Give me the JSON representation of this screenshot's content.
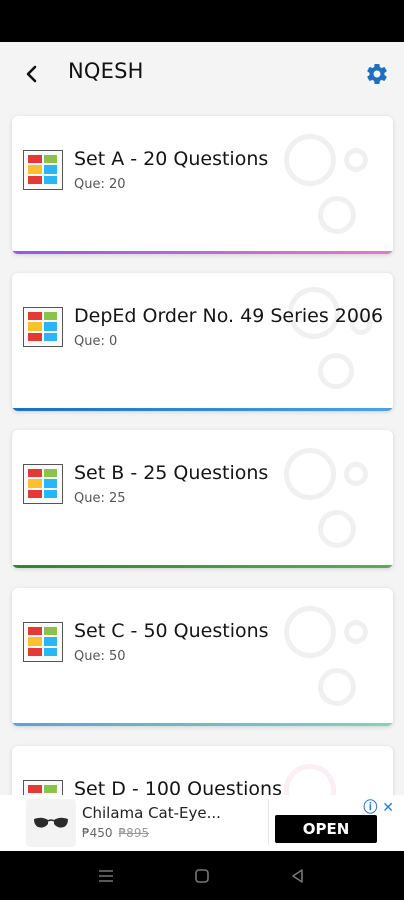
{
  "header": {
    "title": "NQESH"
  },
  "quiz_sets": [
    {
      "name": "Set A - 20 Questions",
      "count": "Que: 20",
      "accent": "#b36be0"
    },
    {
      "name": "DepEd Order No. 49 Series 2006",
      "count": "Que: 0",
      "accent": "#2a7bd4"
    },
    {
      "name": "Set B - 25 Questions",
      "count": "Que: 25",
      "accent": "#2e9a46"
    },
    {
      "name": "Set C - 50 Questions",
      "count": "Que: 50",
      "accent": "#6ab0e6"
    },
    {
      "name": "Set D - 100 Questions",
      "count": "",
      "accent": "#d65a8f"
    }
  ],
  "ad": {
    "title": "Chilama Cat-Eye...",
    "price": "₱450",
    "old_price": "₱895",
    "cta": "OPEN"
  },
  "colors": {
    "settings_icon": "#1d6fc0"
  }
}
